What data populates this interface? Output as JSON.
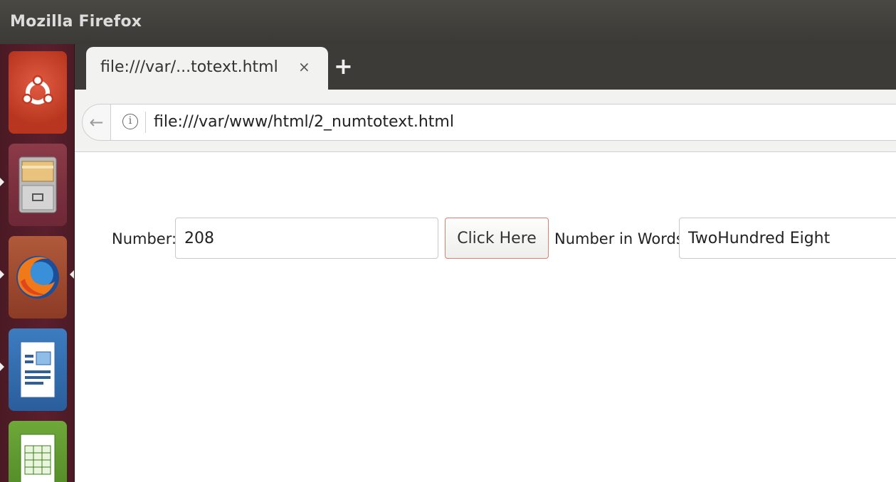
{
  "window": {
    "title": "Mozilla Firefox"
  },
  "launcher": {
    "items": [
      {
        "name": "Ubuntu Dash",
        "icon": "ubuntu-logo-icon"
      },
      {
        "name": "Files",
        "icon": "file-cabinet-icon"
      },
      {
        "name": "Firefox",
        "icon": "firefox-icon"
      },
      {
        "name": "LibreOffice Impress",
        "icon": "presentation-document-icon"
      },
      {
        "name": "LibreOffice Calc",
        "icon": "spreadsheet-icon"
      }
    ]
  },
  "browser": {
    "tab": {
      "title": "file:///var/...totext.html",
      "close": "×"
    },
    "new_tab": "+",
    "back": "←",
    "info": "i",
    "url": "file:///var/www/html/2_numtotext.html"
  },
  "page": {
    "number_label": "Number:",
    "number_value": "208",
    "button_label": "Click Here",
    "words_label": "Number in Words:",
    "words_value": "TwoHundred Eight"
  },
  "colors": {
    "titlebar": "#3b3a36",
    "launcher": "#5a1f2c",
    "button_border": "#d9826a"
  }
}
